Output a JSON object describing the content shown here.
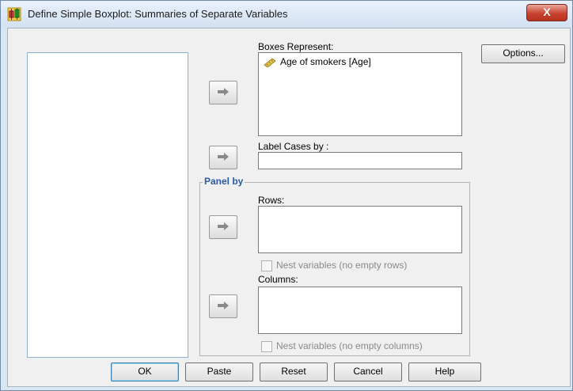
{
  "window": {
    "title": "Define Simple Boxplot: Summaries of Separate Variables",
    "close_glyph": "X",
    "app_icon": "boxplot-chart-icon"
  },
  "boxes": {
    "label": "Boxes Represent:",
    "items": [
      {
        "icon": "ruler-scale-icon",
        "text": "Age of smokers [Age]"
      }
    ]
  },
  "label_cases": {
    "label": "Label Cases by :",
    "value": ""
  },
  "panel": {
    "label": "Panel by",
    "rows": {
      "label": "Rows:",
      "nest_label": "Nest variables (no empty rows)"
    },
    "columns": {
      "label": "Columns:",
      "nest_label": "Nest variables (no empty columns)"
    }
  },
  "buttons": {
    "options": "Options...",
    "ok": "OK",
    "paste": "Paste",
    "reset": "Reset",
    "cancel": "Cancel",
    "help": "Help"
  },
  "colors": {
    "group_label": "#2a5aa8",
    "close_button": "#c7432f"
  }
}
